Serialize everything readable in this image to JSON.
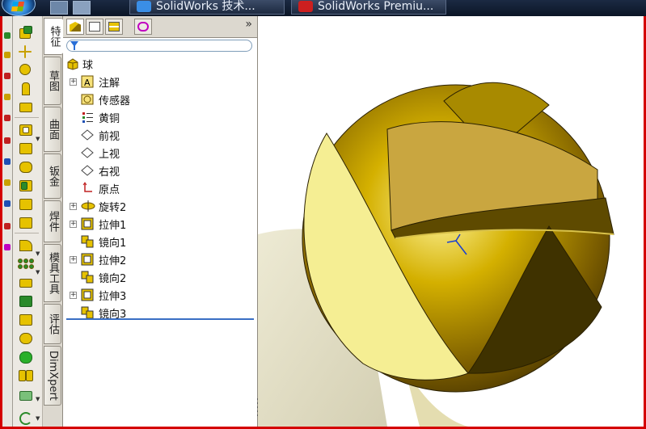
{
  "taskbar": {
    "windows": [
      {
        "label": "SolidWorks 技术...",
        "icon": "internet-explorer-icon",
        "color": "#3a8ee6"
      },
      {
        "label": "SolidWorks Premiu...",
        "icon": "solidworks-icon",
        "color": "#cc1f1f"
      }
    ]
  },
  "side_tabs": [
    {
      "label": "特征",
      "active": true
    },
    {
      "label": "草图",
      "active": false
    },
    {
      "label": "曲面",
      "active": false
    },
    {
      "label": "钣金",
      "active": false
    },
    {
      "label": "焊件",
      "active": false
    },
    {
      "label": "模具工具",
      "active": false
    },
    {
      "label": "评估",
      "active": false
    },
    {
      "label": "DimXpert",
      "active": false
    }
  ],
  "panel": {
    "tabs": [
      {
        "icon": "feature-manager-icon",
        "active": true
      },
      {
        "icon": "property-manager-icon",
        "active": false
      },
      {
        "icon": "configuration-manager-icon",
        "active": false
      },
      {
        "icon": "dimxpert-manager-icon",
        "active": false
      }
    ],
    "more": "»",
    "filter_icon": "filter-icon"
  },
  "tree": {
    "root": {
      "label": "球",
      "icon": "part-icon"
    },
    "items": [
      {
        "label": "注解",
        "icon": "annotations-icon",
        "expandable": true
      },
      {
        "label": "传感器",
        "icon": "sensors-icon",
        "expandable": false
      },
      {
        "label": "黄铜",
        "icon": "material-icon",
        "expandable": false
      },
      {
        "label": "前视",
        "icon": "plane-icon",
        "expandable": false
      },
      {
        "label": "上视",
        "icon": "plane-icon",
        "expandable": false
      },
      {
        "label": "右视",
        "icon": "plane-icon",
        "expandable": false
      },
      {
        "label": "原点",
        "icon": "origin-icon",
        "expandable": false
      },
      {
        "label": "旋转2",
        "icon": "revolve-icon",
        "expandable": true
      },
      {
        "label": "拉伸1",
        "icon": "extrude-icon",
        "expandable": true
      },
      {
        "label": "镜向1",
        "icon": "mirror-icon",
        "expandable": false
      },
      {
        "label": "拉伸2",
        "icon": "extrude-icon",
        "expandable": true
      },
      {
        "label": "镜向2",
        "icon": "mirror-icon",
        "expandable": false
      },
      {
        "label": "拉伸3",
        "icon": "extrude-icon",
        "expandable": true
      },
      {
        "label": "镜向3",
        "icon": "mirror-icon",
        "expandable": false
      }
    ]
  },
  "colors": {
    "brass": "#c9a400",
    "brass_light": "#f3ea8a",
    "brass_dark": "#6b5200",
    "selection": "#3a6fc4"
  }
}
